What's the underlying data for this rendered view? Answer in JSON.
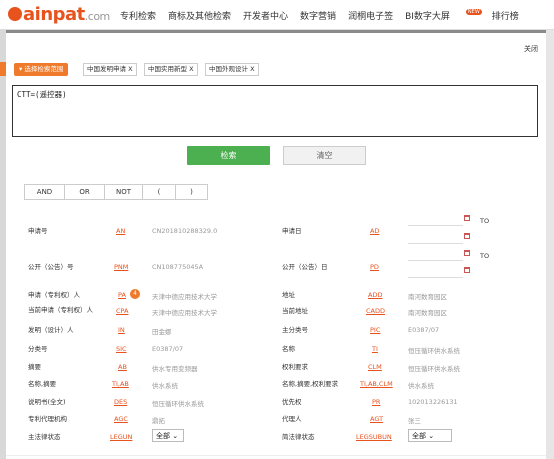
{
  "brand": {
    "name": "ainpat",
    "domain": ".com"
  },
  "nav": [
    {
      "label": "专利检索"
    },
    {
      "label": "商标及其他检索"
    },
    {
      "label": "开发者中心"
    },
    {
      "label": "数字营销"
    },
    {
      "label": "润桐电子签"
    },
    {
      "label": "BI数字大屏",
      "badge": "NEW"
    },
    {
      "label": "排行榜"
    }
  ],
  "modal": {
    "close": "关闭",
    "range_button": "▾ 选择检索范围",
    "tags": [
      "中国发明申请 X",
      "中国实用新型 X",
      "中国外观设计 X"
    ],
    "query": "CTT=(遥控器)",
    "search": "检索",
    "clear": "清空",
    "operators": [
      "AND",
      "OR",
      "NOT",
      "(",
      ")"
    ],
    "to_label": "TO"
  },
  "fields": {
    "r1": {
      "l_label": "申请号",
      "l_code": "AN",
      "l_val": "CN201810288329.0",
      "r_label": "申请日",
      "r_code": "AD"
    },
    "r2": {
      "l_label": "公开（公告）号",
      "l_code": "PNM",
      "l_val": "CN108775045A",
      "r_label": "公开（公告）日",
      "r_code": "PD"
    },
    "r3": {
      "l_label": "申请（专利权）人",
      "l_code": "PA",
      "l_badge": "4",
      "l_val": "天津中德应用技术大学",
      "r_label": "地址",
      "r_code": "ADD",
      "r_val": "南河数育园区"
    },
    "r4": {
      "l_label": "当前申请（专利权）人",
      "l_code": "CPA",
      "l_val": "天津中德应用技术大学",
      "r_label": "当前地址",
      "r_code": "CADD",
      "r_val": "南河数育园区"
    },
    "r5": {
      "l_label": "发明（设计）人",
      "l_code": "IN",
      "l_val": "田金娜",
      "r_label": "主分类号",
      "r_code": "PIC",
      "r_val": "E0387/07"
    },
    "r6": {
      "l_label": "分类号",
      "l_code": "SIC",
      "l_val": "E0387/07",
      "r_label": "名称",
      "r_code": "TI",
      "r_val": "恒压循环供水系统"
    },
    "r7": {
      "l_label": "摘要",
      "l_code": "AB",
      "l_val": "供水专用变频器",
      "r_label": "权利要求",
      "r_code": "CLM",
      "r_val": "恒压循环供水系统"
    },
    "r8": {
      "l_label": "名称,摘要",
      "l_code": "TI,AB",
      "l_val": "供水系统",
      "r_label": "名称,摘要,权利要求",
      "r_code": "TI,AB,CLM",
      "r_val": "供水系统"
    },
    "r9": {
      "l_label": "说明书(全文)",
      "l_code": "DES",
      "l_val": "恒压循环供水系统",
      "r_label": "优先权",
      "r_code": "PR",
      "r_val": "102013226131"
    },
    "r10": {
      "l_label": "专利代理机构",
      "l_code": "AGC",
      "l_val": "鼎拓",
      "r_label": "代理人",
      "r_code": "AGT",
      "r_val": "张三"
    },
    "r11": {
      "l_label": "主法律状态",
      "l_code": "LEGUN",
      "l_sel": "全部",
      "r_label": "简法律状态",
      "r_code": "LEGSUBUN",
      "r_sel": "全部"
    }
  }
}
